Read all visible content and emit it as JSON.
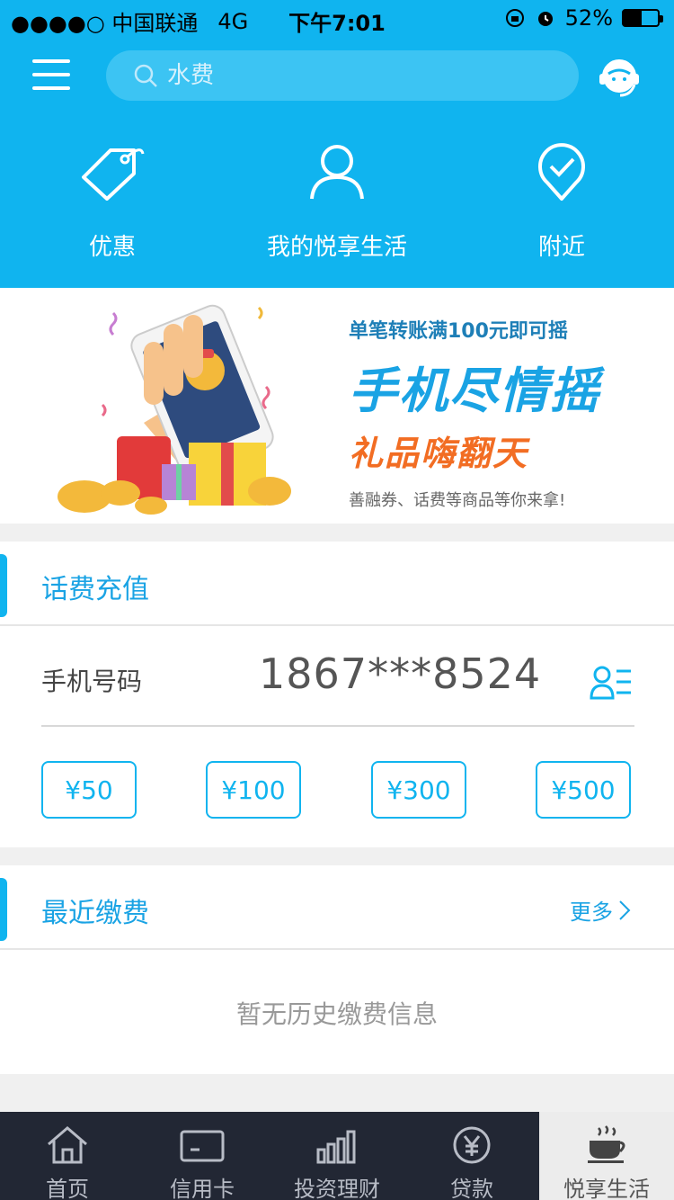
{
  "status_bar": {
    "carrier": "●●●●○ 中国联通",
    "network": "4G",
    "time": "下午7:01",
    "battery": "52%",
    "battery_level": 0.52
  },
  "header": {
    "search_placeholder": "水费",
    "quick_links": [
      {
        "label": "优惠",
        "icon": "tag-icon"
      },
      {
        "label": "我的悦享生活",
        "icon": "user-icon"
      },
      {
        "label": "附近",
        "icon": "location-check-icon"
      }
    ]
  },
  "banner": {
    "line1": "单笔转账满100元即可摇",
    "line2": "手机尽情摇",
    "line3": "礼品嗨翻天",
    "line4": "善融券、话费等商品等你来拿!"
  },
  "recharge": {
    "title": "话费充值",
    "phone_label": "手机号码",
    "phone_number": "1867***8524",
    "amounts": [
      "¥50",
      "¥100",
      "¥300",
      "¥500"
    ]
  },
  "recent": {
    "title": "最近缴费",
    "more_label": "更多",
    "empty_text": "暂无历史缴费信息"
  },
  "tabbar": {
    "items": [
      {
        "label": "首页",
        "icon": "home-icon"
      },
      {
        "label": "信用卡",
        "icon": "credit-card-icon"
      },
      {
        "label": "投资理财",
        "icon": "bar-chart-icon"
      },
      {
        "label": "贷款",
        "icon": "yuan-coin-icon"
      },
      {
        "label": "悦享生活",
        "icon": "coffee-cup-icon"
      }
    ],
    "active_index": 4
  },
  "colors": {
    "primary": "#10b4ef",
    "accent_orange": "#f26d23",
    "tabbar_bg": "#222734"
  }
}
